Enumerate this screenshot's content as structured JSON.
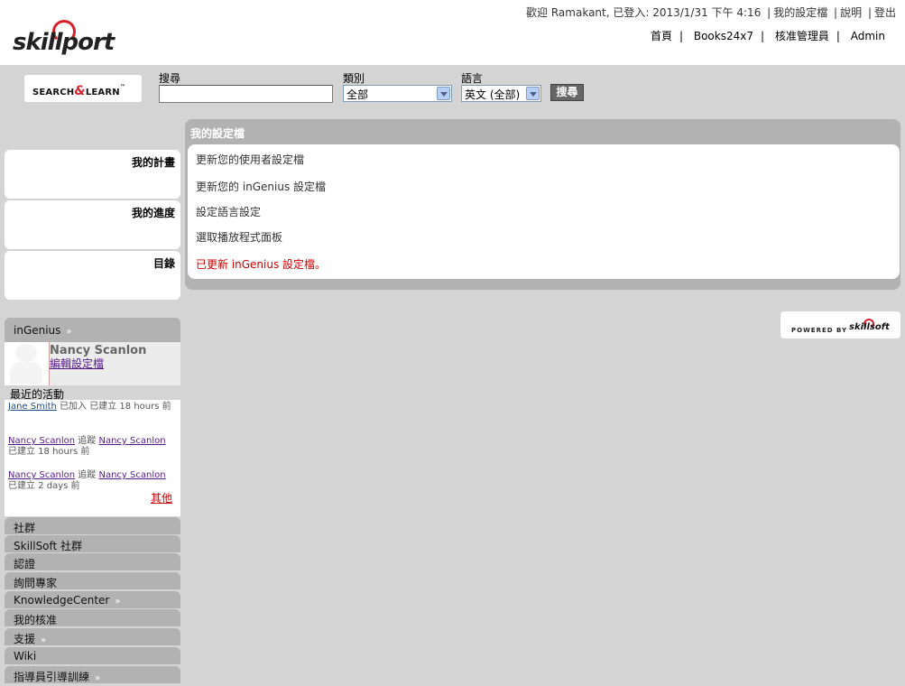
{
  "header": {
    "welcome_prefix": "歡迎",
    "user_line": "Ramakant, 已登入: 2013/1/31 下午 4:16",
    "links": [
      "我的設定檔",
      "說明",
      "登出"
    ],
    "logo_text": "skillport",
    "nav": [
      "首頁",
      "Books24x7",
      "核准管理員",
      "Admin"
    ]
  },
  "search": {
    "logo_part1": "SEARCH",
    "logo_amp": "&",
    "logo_part2": "LEARN",
    "search_label": "搜尋",
    "search_value": "",
    "category_label": "類別",
    "category_value": "全部",
    "language_label": "語言",
    "language_value": "英文 (全部)",
    "button_label": "搜尋"
  },
  "left_boxes": [
    "我的計畫",
    "我的進度",
    "目錄"
  ],
  "profile_panel": {
    "title": "我的設定檔",
    "links": [
      "更新您的使用者設定檔",
      "更新您的 inGenius 設定檔",
      "設定語言設定",
      "選取播放程式面板"
    ],
    "message": "已更新 inGenius 設定檔。"
  },
  "powered": {
    "label": "POWERED BY",
    "brand": "skillsoft"
  },
  "ingenius": {
    "title": "inGenius",
    "chevron": "»",
    "user_name": "Nancy Scanlon",
    "edit_profile": "編輯設定檔",
    "recent_title": "最近的活動",
    "activities": [
      {
        "user": "Jane Smith",
        "action": "已加入 已建立 18 hours 前"
      },
      {
        "user": "Nancy Scanlon",
        "verb": "追蹤",
        "target": "Nancy Scanlon",
        "action": "已建立 18 hours 前"
      },
      {
        "user": "Nancy Scanlon",
        "verb": "追蹤",
        "target": "Nancy Scanlon",
        "action": "已建立 2 days 前"
      }
    ],
    "more": "其他"
  },
  "nav_items": [
    {
      "label": "社群",
      "chevron": ""
    },
    {
      "label": "SkillSoft 社群",
      "chevron": ""
    },
    {
      "label": "認證",
      "chevron": ""
    },
    {
      "label": "詢問專家",
      "chevron": ""
    },
    {
      "label": "KnowledgeCenter",
      "chevron": "»"
    },
    {
      "label": "我的核准",
      "chevron": ""
    },
    {
      "label": "支援",
      "chevron": "»"
    },
    {
      "label": "Wiki",
      "chevron": ""
    },
    {
      "label": "指導員引導訓練",
      "chevron": "»"
    }
  ],
  "colors": {
    "accent": "#d3202a",
    "panel": "#b2b2b2",
    "background": "#d4d4d4",
    "message": "#cc0000"
  }
}
